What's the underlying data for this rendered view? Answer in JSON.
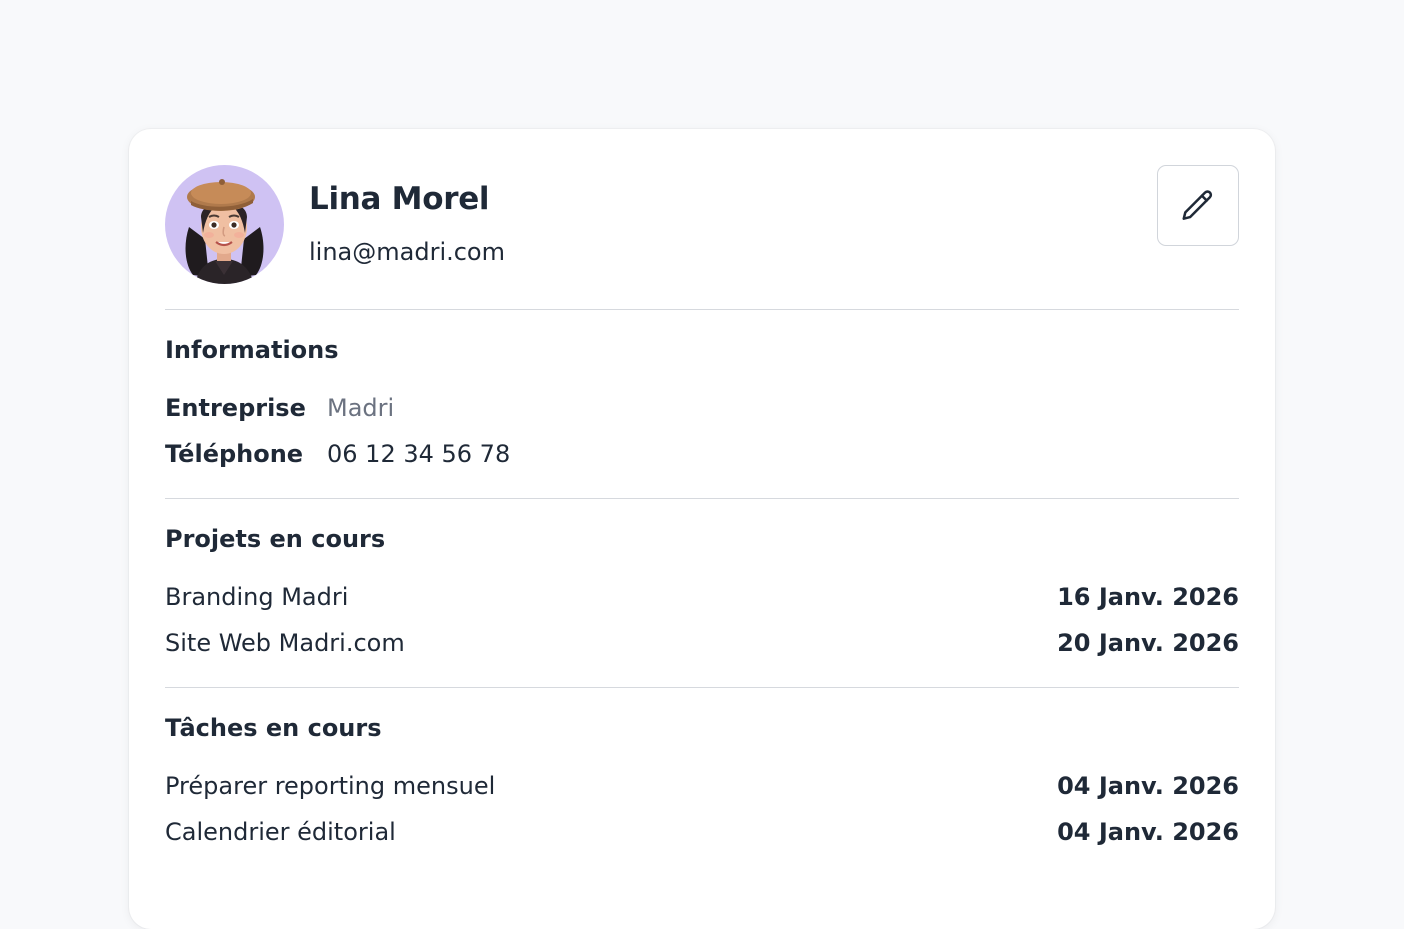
{
  "profile": {
    "name": "Lina Morel",
    "email": "lina@madri.com",
    "avatar_bg": "#cfc2f3"
  },
  "actions": {
    "edit_icon": "pencil-icon"
  },
  "informations": {
    "title": "Informations",
    "rows": [
      {
        "label": "Entreprise",
        "value": "Madri"
      },
      {
        "label": "Téléphone",
        "value": "06 12 34 56 78"
      }
    ]
  },
  "projects": {
    "title": "Projets en cours",
    "items": [
      {
        "name": "Branding Madri",
        "date": "16 Janv. 2026"
      },
      {
        "name": "Site Web Madri.com",
        "date": "20 Janv. 2026"
      }
    ]
  },
  "tasks": {
    "title": "Tâches en cours",
    "items": [
      {
        "name": "Préparer reporting mensuel",
        "date": "04 Janv. 2026"
      },
      {
        "name": "Calendrier éditorial",
        "date": "04 Janv. 2026"
      }
    ]
  },
  "colors": {
    "page_bg": "#f8f9fb",
    "card_bg": "#ffffff",
    "text": "#1f2937",
    "muted": "#6b7280",
    "divider": "#d6d9de"
  }
}
